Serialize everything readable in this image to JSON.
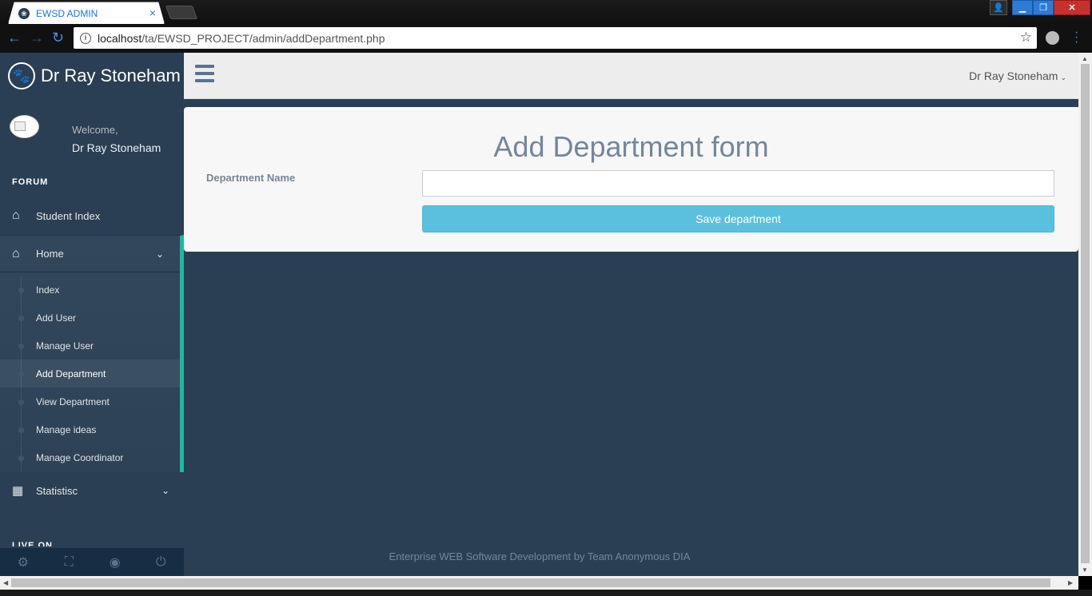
{
  "browser": {
    "tab_title": "EWSD ADMIN",
    "tab_close": "×",
    "url_host": "localhost",
    "url_path": "/ta/EWSD_PROJECT/admin/addDepartment.php"
  },
  "sidebar": {
    "brand": "Dr Ray Stoneham",
    "welcome": "Welcome,",
    "profile_name": "Dr Ray Stoneham",
    "section_title": "FORUM",
    "student_index": "Student Index",
    "home_label": "Home",
    "home_items": [
      {
        "label": "Index"
      },
      {
        "label": "Add User"
      },
      {
        "label": "Manage User"
      },
      {
        "label": "Add Department"
      },
      {
        "label": "View Department"
      },
      {
        "label": "Manage ideas"
      },
      {
        "label": "Manage Coordinator"
      }
    ],
    "statistics_label": "Statistisc",
    "live_on": "LIVE ON",
    "accent_color": "#1abb9c"
  },
  "topnav": {
    "user_name": "Dr Ray Stoneham"
  },
  "form": {
    "title": "Add Department form",
    "department_label": "Department Name",
    "department_value": "",
    "save_label": "Save department",
    "button_color": "#5bc0de"
  },
  "footer": {
    "text": "Enterprise WEB Software Development by Team Anonymous DIA"
  }
}
